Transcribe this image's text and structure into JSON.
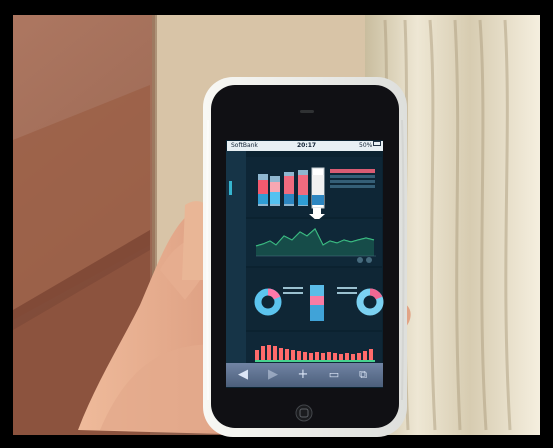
{
  "status_bar": {
    "carrier": "SoftBank",
    "time": "20:17",
    "battery": "50%"
  },
  "toolbar": {
    "back_icon": "back-arrow-icon",
    "forward_icon": "forward-arrow-icon",
    "add_icon": "plus-icon",
    "bookmarks_icon": "book-icon",
    "pages_icon": "pages-icon"
  },
  "colors": {
    "phone_case": "#f3f4f2",
    "screen_bg": "#0b2230",
    "toolbar": "#5d6f8e",
    "curtain": "#ddd4bd",
    "wall": "#b9816a"
  }
}
